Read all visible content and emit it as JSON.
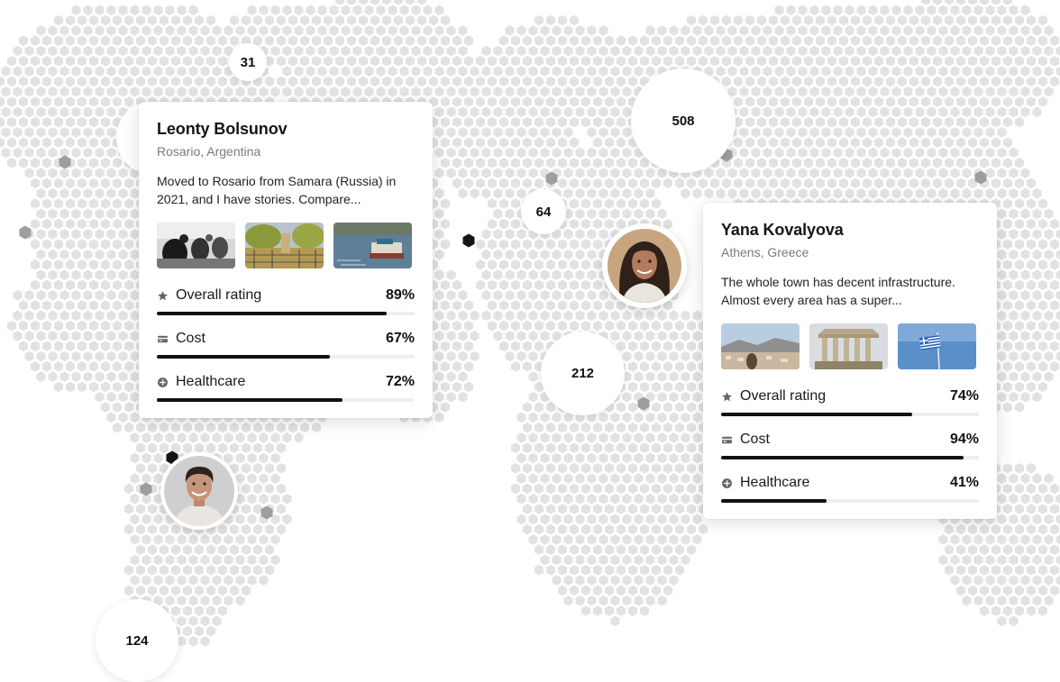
{
  "clusters": [
    {
      "label": "31"
    },
    {
      "label": "508"
    },
    {
      "label": "64"
    },
    {
      "label": "212"
    },
    {
      "label": "124"
    }
  ],
  "cards": [
    {
      "name": "Leonty Bolsunov",
      "location": "Rosario, Argentina",
      "description_line1": "Moved to Rosario from Samara (Russia) in",
      "description_line2": "2021, and I have stories. Compare...",
      "metrics": [
        {
          "label": "Overall rating",
          "value": "89%",
          "fraction": 0.89,
          "icon": "star-icon"
        },
        {
          "label": "Cost",
          "value": "67%",
          "fraction": 0.67,
          "icon": "credit-card-icon"
        },
        {
          "label": "Healthcare",
          "value": "72%",
          "fraction": 0.72,
          "icon": "plus-circle-icon"
        }
      ]
    },
    {
      "name": "Yana Kovalyova",
      "location": "Athens, Greece",
      "description_line1": "The whole town has decent infrastructure.",
      "description_line2": "Almost every area has a super...",
      "metrics": [
        {
          "label": "Overall rating",
          "value": "74%",
          "fraction": 0.74,
          "icon": "star-icon"
        },
        {
          "label": "Cost",
          "value": "94%",
          "fraction": 0.94,
          "icon": "credit-card-icon"
        },
        {
          "label": "Healthcare",
          "value": "41%",
          "fraction": 0.41,
          "icon": "plus-circle-icon"
        }
      ]
    }
  ],
  "colors": {
    "hex_light": "#e2e2e2",
    "hex_mid": "#9e9e9e",
    "hex_dark": "#161616",
    "bar_fill": "#111111",
    "bar_track": "#eeeeee"
  }
}
